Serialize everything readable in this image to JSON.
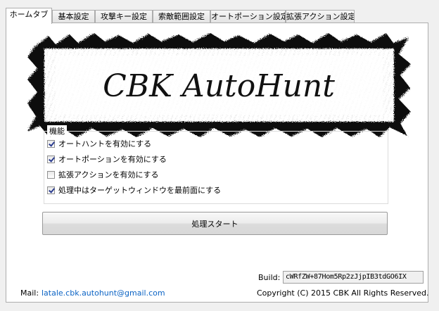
{
  "tabs": [
    {
      "label": "ホームタブ",
      "active": true
    },
    {
      "label": "基本設定",
      "active": false
    },
    {
      "label": "攻撃キー設定",
      "active": false
    },
    {
      "label": "索敵範囲設定",
      "active": false
    },
    {
      "label": "オートポーション設定",
      "active": false
    },
    {
      "label": "拡張アクション設定",
      "active": false
    }
  ],
  "banner": {
    "title": "CBK AutoHunt"
  },
  "features": {
    "legend": "機能",
    "items": [
      {
        "label": "オートハントを有効にする",
        "checked": true
      },
      {
        "label": "オートポーションを有効にする",
        "checked": true
      },
      {
        "label": "拡張アクションを有効にする",
        "checked": false
      },
      {
        "label": "処理中はターゲットウィンドウを最前面にする",
        "checked": true
      }
    ]
  },
  "start_button": {
    "label": "処理スタート"
  },
  "build": {
    "label": "Build:",
    "value": "cWRfZW+87Hom5Rp2zJjpIB3tdGO6IX"
  },
  "footer": {
    "mail_label": "Mail:",
    "mail": "latale.cbk.autohunt@gmail.com",
    "copyright": "Copyright (C) 2015 CBK All Rights Reserved."
  },
  "colors": {
    "link": "#0b63c4",
    "check": "#2b3c8f",
    "panel": "#ffffff",
    "window": "#f0f0f0"
  }
}
